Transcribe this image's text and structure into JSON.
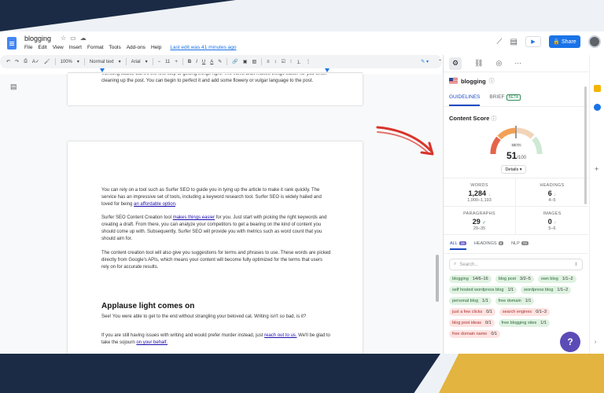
{
  "doc": {
    "title": "blogging",
    "menu": [
      "File",
      "Edit",
      "View",
      "Insert",
      "Format",
      "Tools",
      "Add-ons",
      "Help"
    ],
    "last_edit": "Last edit was 41 minutes ago"
  },
  "header": {
    "share_label": "Share"
  },
  "toolbar": {
    "zoom": "100%",
    "style": "Normal text",
    "font": "Arial",
    "size": "11"
  },
  "page1": {
    "para": "Vomiting sucks, but it's the first step to getting things right. The vomit draft makes things easier for you when cleaning up the post. You can begin to perfect it and add some flowery or vulgar language to the post."
  },
  "page2": {
    "p1_a": "You can rely on a tool such as Surfer SEO to guide you in tying up the article to make it rank quickly. The service has an impressive set of tools, including a keyword research tool. Surfer SEO is widely hailed and loved for being",
    "p1_link": "an affordable option",
    "p1_b": ".",
    "p2_a": "Surfer SEO Content Creation tool",
    "p2_link": "makes things easier",
    "p2_b": "for you. Just start with picking the right keywords and creating a draft. From there, you can analyze your competitors to get a bearing on the kind of content you should come up with. Subsequently, Surfer SEO will provide you with metrics such as word count that you should aim for.",
    "p3": "The content creation tool will also give you suggestions for terms and phrases to use. These words are picked directly from Google's APIs, which means your content will become fully optimized for the terms that users rely on for accurate results.",
    "heading": "Applause light comes on",
    "p4": "See! You were able to get to the end without strangling your beloved cat. Writing isn't so bad, is it?",
    "p5_a": "If you are still having issues with writing and would prefer murder instead, just",
    "p5_link": "reach out to us.",
    "p5_b": "We'll be glad to take the sojourn",
    "p5_link2": "on your behalf."
  },
  "surfer": {
    "keyword": "blogging",
    "tab_guidelines": "GUIDELINES",
    "tab_brief": "BRIEF",
    "beta": "BETA",
    "content_score_label": "Content Score",
    "gauge_beta": "BETA",
    "score": "51",
    "score_max": "/100",
    "details": "Details",
    "stats": {
      "words": {
        "label": "WORDS",
        "value": "1,284",
        "mark": "↓",
        "range": "1,000–1,193"
      },
      "headings": {
        "label": "HEADINGS",
        "value": "6",
        "mark": "↓",
        "range": "4–5"
      },
      "paragraphs": {
        "label": "PARAGRAPHS",
        "value": "29",
        "mark": "✓",
        "range": "29–35"
      },
      "images": {
        "label": "IMAGES",
        "value": "0",
        "mark": "↑",
        "range": "5–6"
      }
    },
    "filters": {
      "all": "ALL",
      "all_count": "15",
      "headings": "HEADINGS",
      "headings_count": "6",
      "nlp": "NLP",
      "nlp_count": "74"
    },
    "search_placeholder": "Search...",
    "terms": [
      {
        "term": "blogging",
        "count": "14/6–16",
        "status": "ok"
      },
      {
        "term": "blog post",
        "count": "3/2–5",
        "status": "ok"
      },
      {
        "term": "own blog",
        "count": "1/1–2",
        "status": "ok"
      },
      {
        "term": "self hosted wordpress blog",
        "count": "1/1",
        "status": "ok"
      },
      {
        "term": "wordpress blog",
        "count": "1/1–2",
        "status": "ok"
      },
      {
        "term": "personal blog",
        "count": "1/1",
        "status": "ok"
      },
      {
        "term": "free domain",
        "count": "1/1",
        "status": "ok"
      },
      {
        "term": "just a few clicks",
        "count": "0/1",
        "status": "miss"
      },
      {
        "term": "search engines",
        "count": "0/1–3",
        "status": "miss"
      },
      {
        "term": "blog post ideas",
        "count": "0/1",
        "status": "miss"
      },
      {
        "term": "free blogging sites",
        "count": "1/1",
        "status": "ok"
      },
      {
        "term": "free domain name",
        "count": "0/1",
        "status": "miss"
      }
    ],
    "help": "?"
  },
  "colors": {
    "share": "#1a73e8",
    "accent_blue": "#1d4bc2",
    "ok_chip": "#dff2e1",
    "miss_chip": "#fde3e1",
    "help": "#5b4bb7",
    "bg_navy": "#1b2b45",
    "bg_gold": "#e3b43f"
  }
}
